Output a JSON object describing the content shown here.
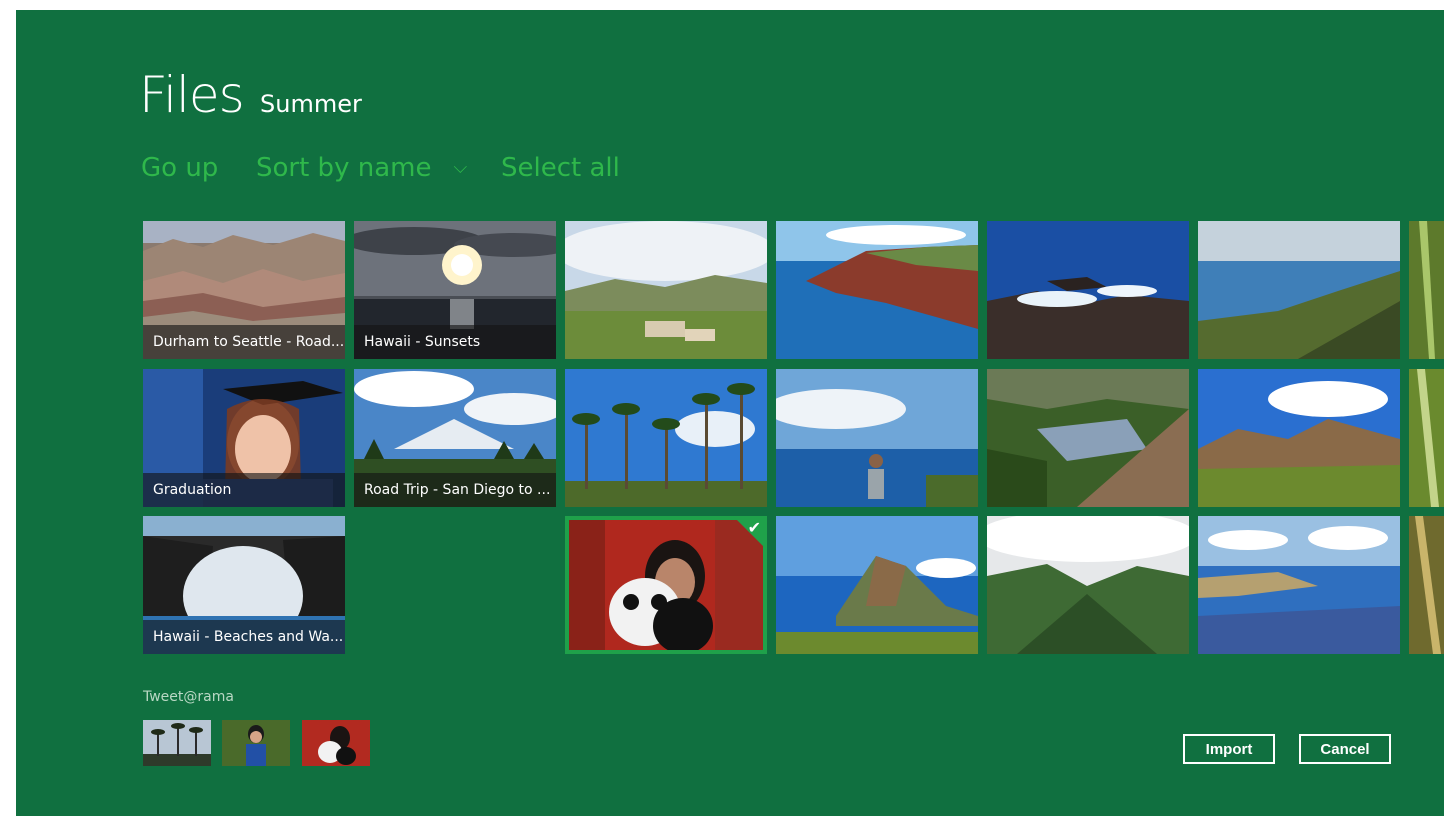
{
  "header": {
    "title": "Files",
    "location": "Summer"
  },
  "commands": {
    "go_up": "Go up",
    "sort": "Sort by name",
    "sort_chevron": "⌵",
    "select_all": "Select all"
  },
  "tiles": [
    {
      "label": "Durham to Seattle - Road..."
    },
    {
      "label": "Hawaii - Sunsets"
    },
    {
      "label": "Graduation"
    },
    {
      "label": "Road Trip - San Diego to ..."
    },
    {
      "label": "Hawaii - Beaches and Wa..."
    }
  ],
  "basket": {
    "label": "Tweet@rama"
  },
  "buttons": {
    "import": "Import",
    "cancel": "Cancel"
  },
  "colors": {
    "background": "#107040",
    "accent": "#1fa14a",
    "command_text": "#2fb84b"
  },
  "icons": {
    "selected_check": "check-icon"
  }
}
